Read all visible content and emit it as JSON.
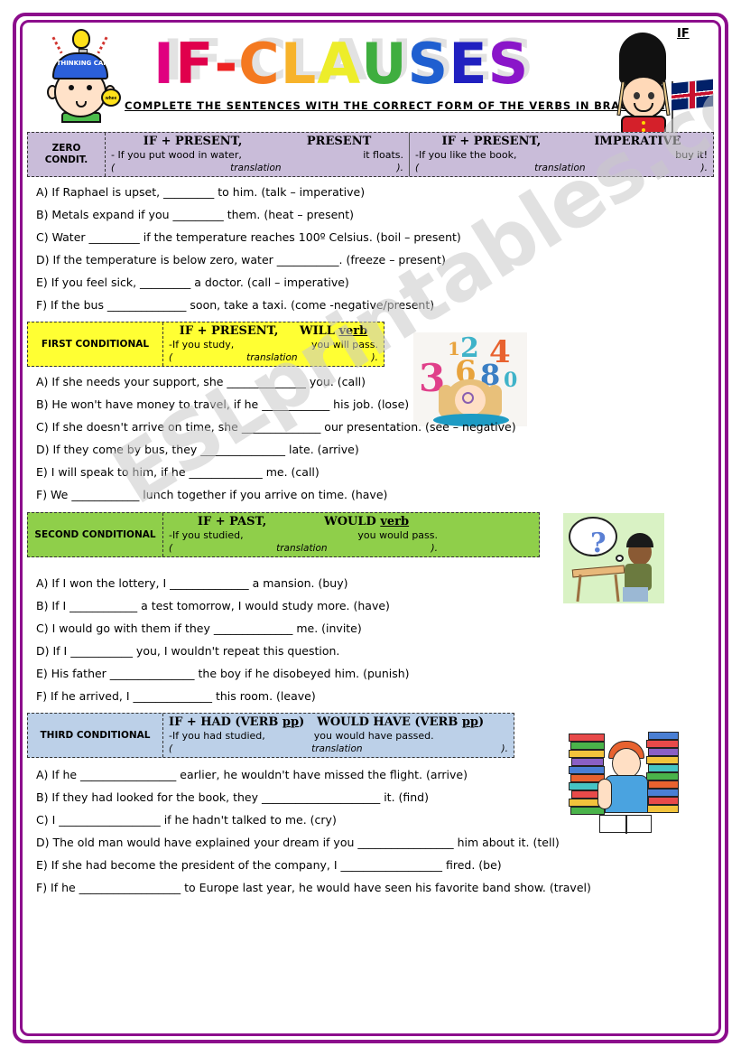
{
  "worksheet": {
    "title": "IF-CLAUSES",
    "title_letters": [
      {
        "ch": "I",
        "color": "#e0007f"
      },
      {
        "ch": "F",
        "color": "#e0004c"
      },
      {
        "ch": "-",
        "color": "#ee2222"
      },
      {
        "ch": "C",
        "color": "#f47920"
      },
      {
        "ch": "L",
        "color": "#f7b32b"
      },
      {
        "ch": "A",
        "color": "#eded2a"
      },
      {
        "ch": "U",
        "color": "#3fae3f"
      },
      {
        "ch": "S",
        "color": "#1f5fd0"
      },
      {
        "ch": "E",
        "color": "#2020c0"
      },
      {
        "ch": "S",
        "color": "#8a15c9"
      }
    ],
    "instruction": "COMPLETE THE SENTENCES WITH THE CORRECT FORM OF THE VERBS IN BRACKETS:",
    "guard_label": "IF",
    "watermark": "ESLprintables.com",
    "border_color": "#8c0d8c"
  },
  "decorations": {
    "thinking_cap_text": "THINKING CAP",
    "thinking_badge_text": "whee",
    "question_mark": "?",
    "floating_numbers": [
      "1",
      "2",
      "3",
      "4",
      "6",
      "8",
      "0"
    ]
  },
  "sections": [
    {
      "id": "zero",
      "label": "ZERO CONDIT.",
      "label_lines": [
        "ZERO",
        "CONDIT."
      ],
      "color": "#c9bcd9",
      "columns": [
        {
          "formula_left": "IF + PRESENT,",
          "formula_right": "PRESENT",
          "example_left": "- If you put wood in water,",
          "example_right": "it floats.",
          "translation_open": "(",
          "translation_word": "translation",
          "translation_close": ")."
        },
        {
          "formula_left": "IF + PRESENT,",
          "formula_right": "IMPERATIVE",
          "example_left": "-If you like the book,",
          "example_right": "buy it!",
          "translation_open": "(",
          "translation_word": "translation",
          "translation_close": ")."
        }
      ],
      "exercises": [
        "A) If Raphael is upset, _________ to him.  (talk – imperative)",
        "B) Metals expand if you _________ them. (heat – present)",
        "C) Water _________ if  the temperature reaches 100º Celsius. (boil – present)",
        "D) If the temperature is below zero, water ___________. (freeze – present)",
        "E) If you feel sick, _________ a doctor. (call – imperative)",
        "F) If the bus ______________ soon, take a taxi. (come -negative/present)"
      ]
    },
    {
      "id": "first",
      "label": "FIRST CONDITIONAL",
      "label_lines": [
        "FIRST CONDITIONAL"
      ],
      "color": "#ffff33",
      "columns": [
        {
          "formula_left": "IF + PRESENT,",
          "formula_right_plain": "WILL ",
          "formula_right_underlined": "verb",
          "example_left": "-If you study,",
          "example_right": "you will pass.",
          "translation_open": "(",
          "translation_word": "translation",
          "translation_close": ")."
        }
      ],
      "exercises": [
        "A) If she needs your support, she ______________ you. (call)",
        "B) He won't have money to travel, if he ____________ his job. (lose)",
        "C) If she doesn't arrive on time, she ______________ our presentation. (see – negative)",
        "D) If they come by bus, they _______________ late. (arrive)",
        "E) I will speak to him, if he _____________ me. (call)",
        " F) We ____________ lunch together if you arrive on time. (have)"
      ]
    },
    {
      "id": "second",
      "label": "SECOND CONDITIONAL",
      "label_lines": [
        "SECOND CONDITIONAL"
      ],
      "color": "#8fcf4a",
      "columns": [
        {
          "formula_left": "IF + PAST,",
          "formula_right_plain": "WOULD ",
          "formula_right_underlined": "verb",
          "example_left": "-If you studied,",
          "example_right": "you would pass.",
          "translation_open": "(",
          "translation_word": "translation",
          "translation_close": ")."
        }
      ],
      "exercises": [
        "A) If I won the lottery, I ______________ a mansion. (buy)",
        "B) If I ____________ a test tomorrow, I would study more. (have)",
        "C)  I would go with them if they ______________ me. (invite)",
        "D) If I ___________ you, I wouldn't repeat this question.",
        "E) His father _______________ the boy if he disobeyed him. (punish)",
        "F)  If he arrived, I ______________ this room. (leave)"
      ]
    },
    {
      "id": "third",
      "label": "THIRD CONDITIONAL",
      "label_lines": [
        "THIRD CONDITIONAL"
      ],
      "color": "#bcd0e8",
      "columns": [
        {
          "formula_left_plain": "IF + HAD (VERB ",
          "formula_left_underlined": "pp",
          "formula_left_close": ")",
          "formula_right_plain": "WOULD HAVE (VERB ",
          "formula_right_underlined": "pp",
          "formula_right_close": ")",
          "example_left": "-If you had studied,",
          "example_right": "you would have passed.",
          "translation_open": "(",
          "translation_word": "translation",
          "translation_close": ")."
        }
      ],
      "exercises": [
        "A) If he _________________ earlier, he wouldn't have missed the flight. (arrive)",
        "B) If they had looked for the book, they _____________________ it. (find)",
        "C) I __________________ if he hadn't talked to me. (cry)",
        "D) The old man would have explained your dream if you _________________ him about it. (tell)",
        "E) If she had become the president of the company, I __________________ fired. (be)",
        "F) If he __________________ to Europe last year, he would have seen his favorite band show. (travel)"
      ]
    }
  ]
}
